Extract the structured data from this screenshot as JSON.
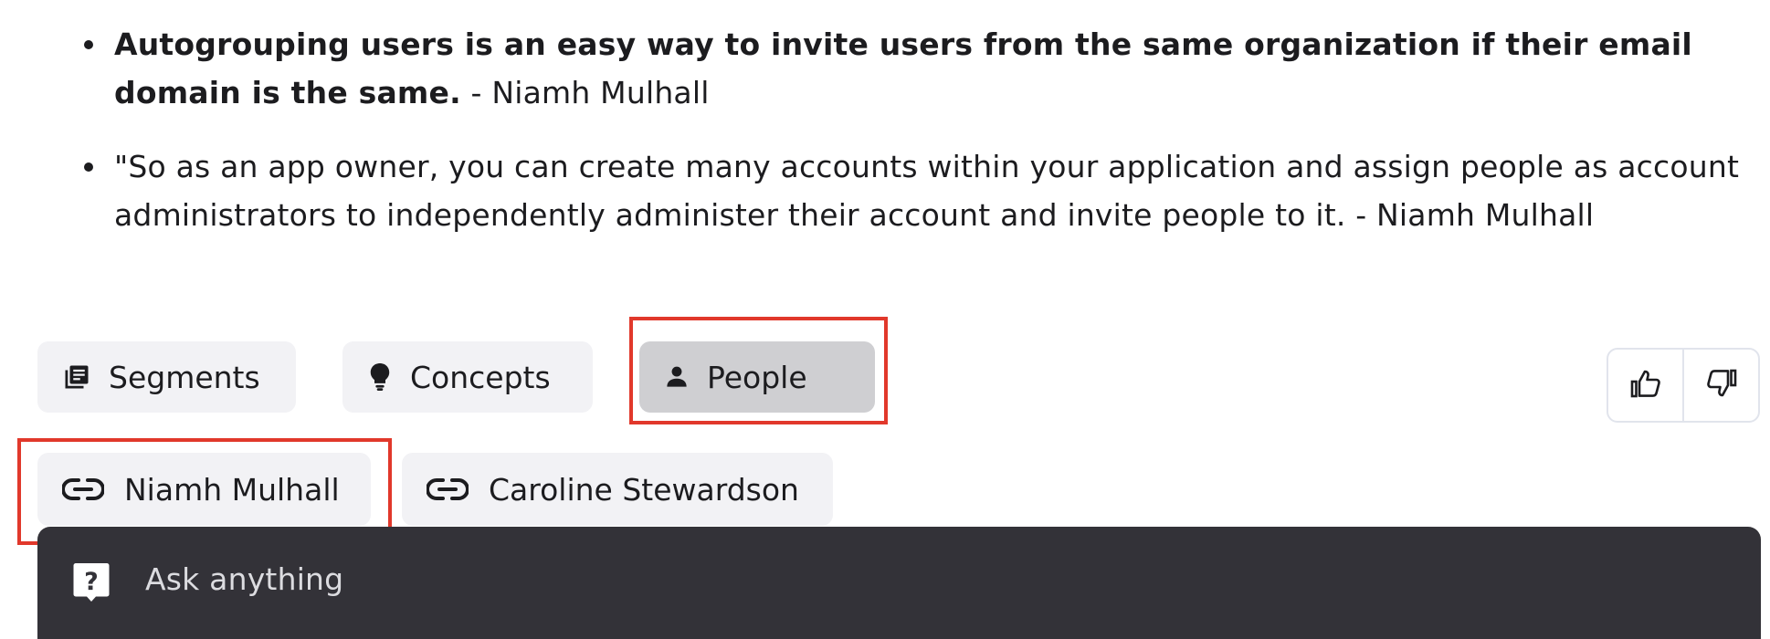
{
  "bullets": [
    {
      "bold_text": "Autogrouping users is an easy way to invite users from the same organization if their email domain is the same.",
      "normal_text": " - Niamh Mulhall"
    },
    {
      "bold_text": "",
      "normal_text": "\"So as an app owner, you can create many accounts within your application and assign people as account administrators to independently administer their account and invite people to it. - Niamh Mulhall"
    }
  ],
  "filter_tabs": {
    "segments": {
      "label": "Segments",
      "icon": "library-books-icon"
    },
    "concepts": {
      "label": "Concepts",
      "icon": "lightbulb-icon"
    },
    "people": {
      "label": "People",
      "icon": "person-icon",
      "active": true
    }
  },
  "people_links": [
    {
      "label": "Niamh Mulhall",
      "icon": "link-icon"
    },
    {
      "label": "Caroline Stewardson",
      "icon": "link-icon"
    }
  ],
  "feedback": {
    "thumbs_up_icon": "thumbs-up-icon",
    "thumbs_down_icon": "thumbs-down-icon"
  },
  "ask_bar": {
    "placeholder": "Ask anything",
    "icon": "question-bubble-icon"
  },
  "colors": {
    "highlight": "#e1382b",
    "chip_bg": "#f2f2f5",
    "chip_active_bg": "#cfcfd2",
    "ask_bar_bg": "#333238"
  }
}
